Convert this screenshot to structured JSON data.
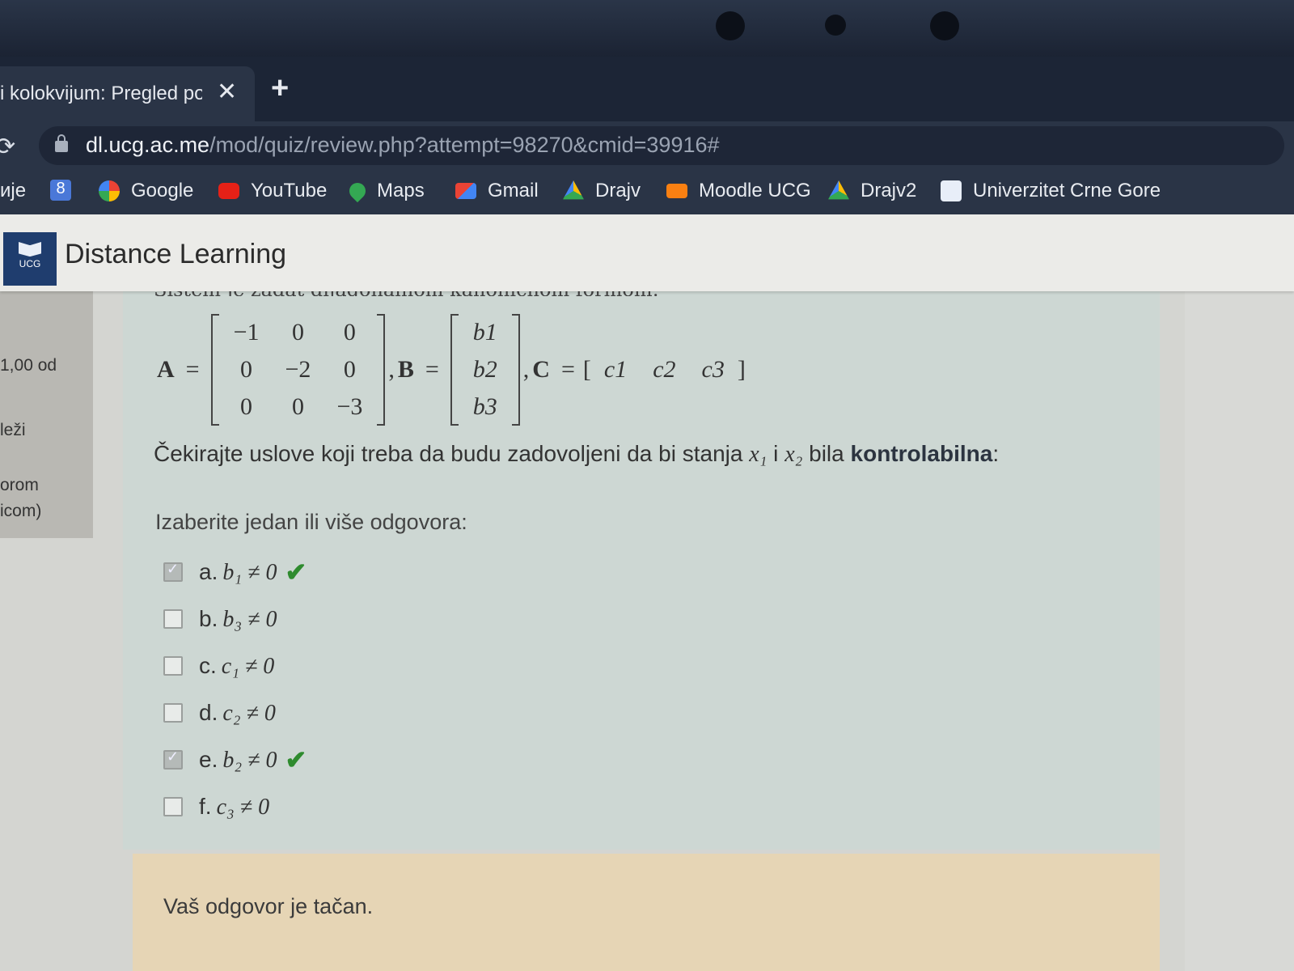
{
  "browser": {
    "tab_title": "i kolokvijum: Pregled po",
    "tab_close": "✕",
    "new_tab": "+",
    "url_host": "dl.ucg.ac.me",
    "url_path": "/mod/quiz/review.php?attempt=98270&cmid=39916#",
    "bookmarks": [
      {
        "label": "ије",
        "icon": "apps-icon"
      },
      {
        "label": "",
        "icon": "8-icon"
      },
      {
        "label": "Google",
        "icon": "google-icon"
      },
      {
        "label": "YouTube",
        "icon": "youtube-icon"
      },
      {
        "label": "Maps",
        "icon": "maps-icon"
      },
      {
        "label": "Gmail",
        "icon": "gmail-icon"
      },
      {
        "label": "Drajv",
        "icon": "drive-icon"
      },
      {
        "label": "Moodle UCG",
        "icon": "moodle-icon"
      },
      {
        "label": "Drajv2",
        "icon": "drive-icon"
      },
      {
        "label": "Univerzitet Crne Gore",
        "icon": "ucg-icon"
      }
    ]
  },
  "site": {
    "logo_text": "UCG",
    "name": "Distance Learning"
  },
  "left_panel": {
    "line1": "1,00 od",
    "line2": "leži",
    "line3": "orom",
    "line4": "icom)"
  },
  "question": {
    "intro_cut": "Sistem je zadat dijagonalnom kanoničnom formom:",
    "matrix_A": [
      [
        "−1",
        "0",
        "0"
      ],
      [
        "0",
        "−2",
        "0"
      ],
      [
        "0",
        "0",
        "−3"
      ]
    ],
    "matrix_B": [
      "b1",
      "b2",
      "b3"
    ],
    "matrix_C": [
      "c1",
      "c2",
      "c3"
    ],
    "text_before": "Čekirajte uslove koji treba da budu zadovoljeni da bi stanja ",
    "x1": "x₁",
    "text_and": " i ",
    "x2": "x₂",
    "text_bila": " bila ",
    "bold_word": "kontrolabilna",
    "text_end": ":",
    "prompt": "Izaberite jedan ili više odgovora:",
    "answers": [
      {
        "letter": "a.",
        "expr": "b₁ ≠ 0",
        "checked": true,
        "correct": true
      },
      {
        "letter": "b.",
        "expr": "b₃ ≠ 0",
        "checked": false,
        "correct": false
      },
      {
        "letter": "c.",
        "expr": "c₁ ≠ 0",
        "checked": false,
        "correct": false
      },
      {
        "letter": "d.",
        "expr": "c₂ ≠ 0",
        "checked": false,
        "correct": false
      },
      {
        "letter": "e.",
        "expr": "b₂ ≠ 0",
        "checked": true,
        "correct": true
      },
      {
        "letter": "f.",
        "expr": "c₃ ≠ 0",
        "checked": false,
        "correct": false
      }
    ]
  },
  "feedback": "Vaš odgovor je tačan.",
  "labels": {
    "A": "A",
    "B": "B",
    "C": "C",
    "eq": "=",
    "comma": ","
  },
  "colors": {
    "correct": "#2e8b2e",
    "feedback_bg": "#e6d5b5",
    "question_bg": "#cdd7d3"
  }
}
